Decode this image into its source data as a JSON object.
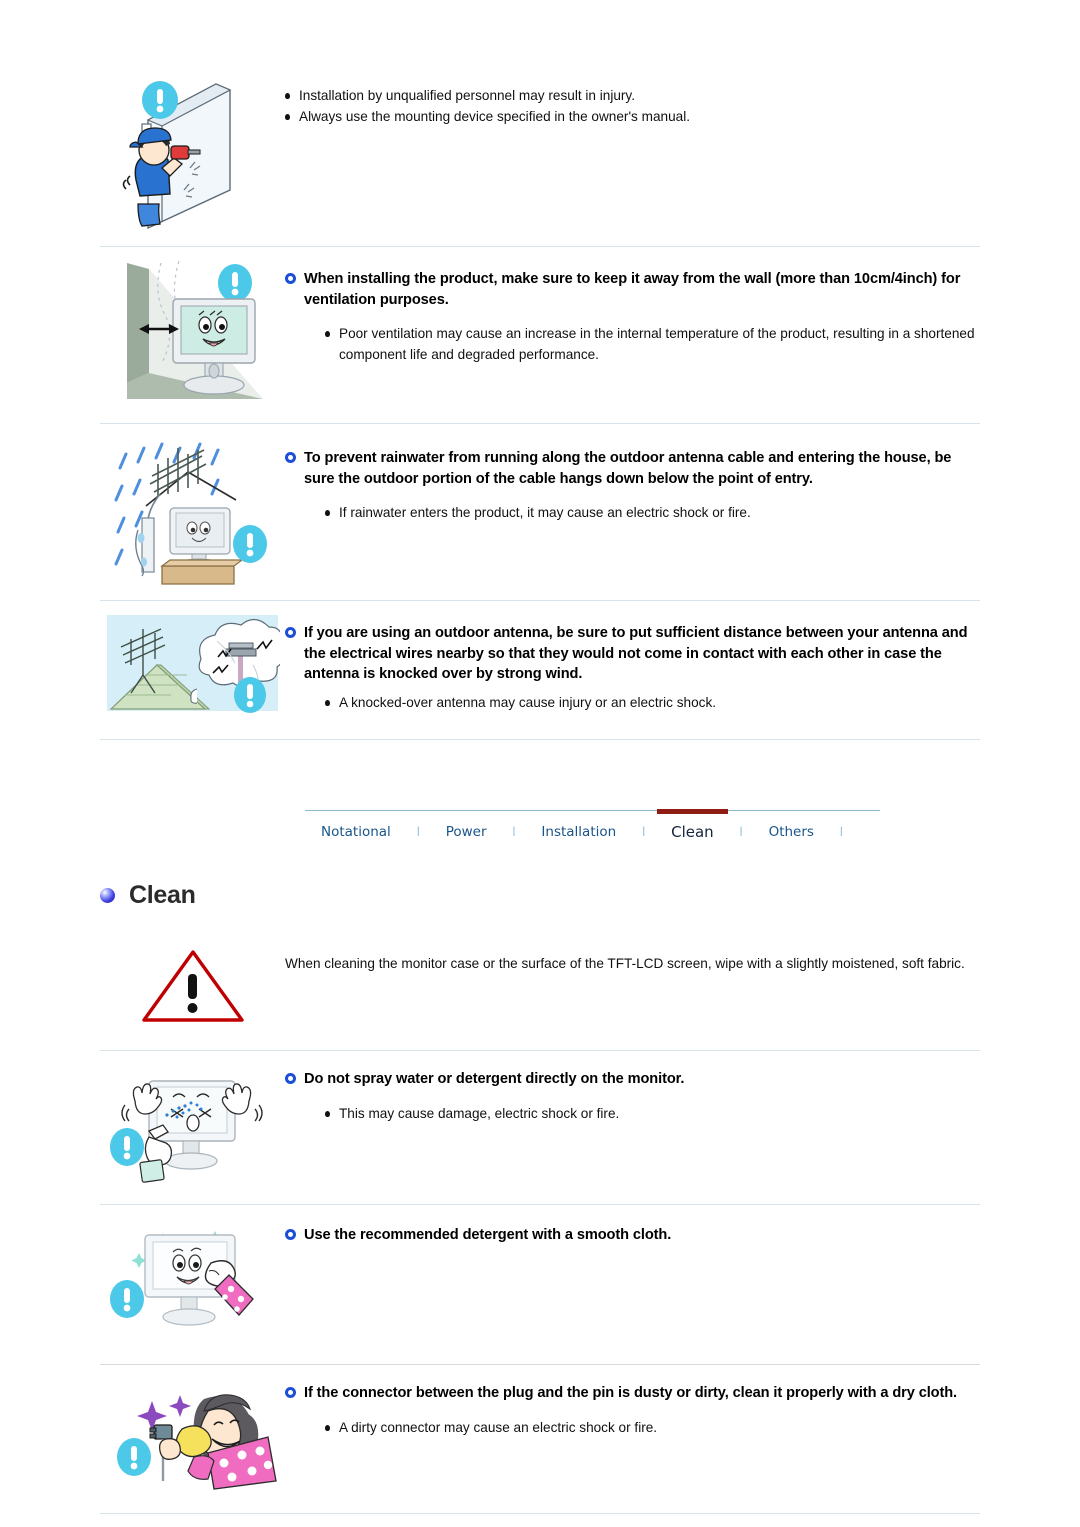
{
  "sections": {
    "install_qualified": {
      "bullets": [
        "Installation by unqualified personnel may result in injury.",
        "Always use the mounting device specified in the owner's manual."
      ]
    },
    "ventilation": {
      "heading": "When installing the product, make sure to keep it away from the wall (more than 10cm/4inch) for ventilation purposes.",
      "bullets": [
        "Poor ventilation may cause an increase in the internal temperature of the product, resulting in a shortened component life and degraded performance."
      ]
    },
    "rainwater": {
      "heading": "To prevent rainwater from running along the outdoor antenna cable and entering the house, be sure the outdoor portion of the cable hangs down below the point of entry.",
      "bullets": [
        "If rainwater enters the product, it may cause an electric shock or fire."
      ]
    },
    "outdoor_antenna": {
      "heading": "If you are using an outdoor antenna, be sure to put sufficient distance between your antenna and the electrical wires nearby so that they would not come in contact with each other in case the antenna is knocked over by strong wind.",
      "bullets": [
        "A knocked-over antenna may cause injury or an electric shock."
      ]
    },
    "clean_intro": {
      "paragraph": "When cleaning the monitor case or the surface of the TFT-LCD screen, wipe with a slightly moistened, soft fabric."
    },
    "no_spray": {
      "heading": "Do not spray water or detergent directly on the monitor.",
      "bullets": [
        "This may cause damage, electric shock or fire."
      ]
    },
    "recommended_detergent": {
      "heading": "Use the recommended detergent with a smooth cloth.",
      "bullets": []
    },
    "connector": {
      "heading": "If the connector between the plug and the pin is dusty or dirty, clean it properly with a dry cloth.",
      "bullets": [
        "A dirty connector may cause an electric shock or fire."
      ]
    }
  },
  "tabs": {
    "items": [
      {
        "label": "Notational",
        "active": false
      },
      {
        "label": "Power",
        "active": false
      },
      {
        "label": "Installation",
        "active": false
      },
      {
        "label": "Clean",
        "active": true
      },
      {
        "label": "Others",
        "active": false
      }
    ],
    "separator": "l"
  },
  "page_title": "Clean",
  "colors": {
    "tab_text": "#19558a",
    "tab_active_text": "#15243f",
    "tab_active_underline": "#8f1d13",
    "tab_rule": "#8fb8cf",
    "ring_bullet": "#1b4fd8",
    "title_bullet": "#3d3ddd",
    "warning_triangle": "#c00000",
    "badge_cyan": "#4cc8e8",
    "divider": "#d9e3ea"
  }
}
